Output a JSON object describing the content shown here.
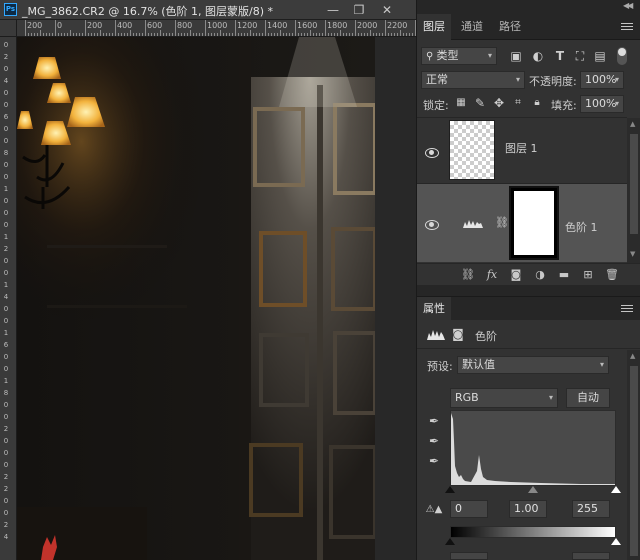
{
  "document": {
    "title": "_MG_3862.CR2 @ 16.7% (色阶 1, 图层蒙版/8) *",
    "badge": "Ps",
    "window_buttons": {
      "minimize": "—",
      "maximize": "❐",
      "close": "✕"
    },
    "ruler_h": [
      "200",
      "0",
      "200",
      "400",
      "600",
      "800",
      "1000",
      "1200",
      "1400",
      "1600",
      "1800",
      "2000",
      "2200",
      "2400"
    ],
    "ruler_v": [
      "0",
      "2",
      "0",
      "4",
      "0",
      "0",
      "6",
      "0",
      "0",
      "8",
      "0",
      "0",
      "1",
      "0",
      "0",
      "0",
      "1",
      "2",
      "0",
      "0",
      "1",
      "4",
      "0",
      "0",
      "1",
      "6",
      "0",
      "0",
      "1",
      "8",
      "0",
      "0",
      "2",
      "0",
      "0",
      "0",
      "2",
      "2",
      "0",
      "0",
      "2",
      "4"
    ]
  },
  "layers_panel": {
    "tabs": [
      "图层",
      "通道",
      "路径"
    ],
    "active_tab": "图层",
    "filter": {
      "icon": "search-icon",
      "value": "类型"
    },
    "blend_mode": "正常",
    "opacity_label": "不透明度:",
    "opacity_value": "100%",
    "lock_label": "锁定:",
    "fill_label": "填充:",
    "fill_value": "100%",
    "layers": [
      {
        "name": "图层 1",
        "visible": true,
        "thumbnail": "transparent"
      },
      {
        "name": "色阶 1",
        "visible": true,
        "thumbnail": "white-mask",
        "selected": true
      }
    ],
    "bottom_icons": [
      "link-icon",
      "fx-icon",
      "mask-icon",
      "adjustment-icon",
      "folder-icon",
      "new-layer-icon",
      "trash-icon"
    ]
  },
  "properties_panel": {
    "tab": "属性",
    "title": "色阶",
    "preset_label": "预设:",
    "preset_value": "默认值",
    "channel_value": "RGB",
    "auto_label": "自动",
    "input_black": "0",
    "input_gamma": "1.00",
    "input_white": "255",
    "histogram_color": "#dcdcdc"
  },
  "colors": {
    "accent": "#31a8ff",
    "panel_bg": "#323232",
    "tab_bar_bg": "#262626",
    "selected_row": "#545454"
  }
}
